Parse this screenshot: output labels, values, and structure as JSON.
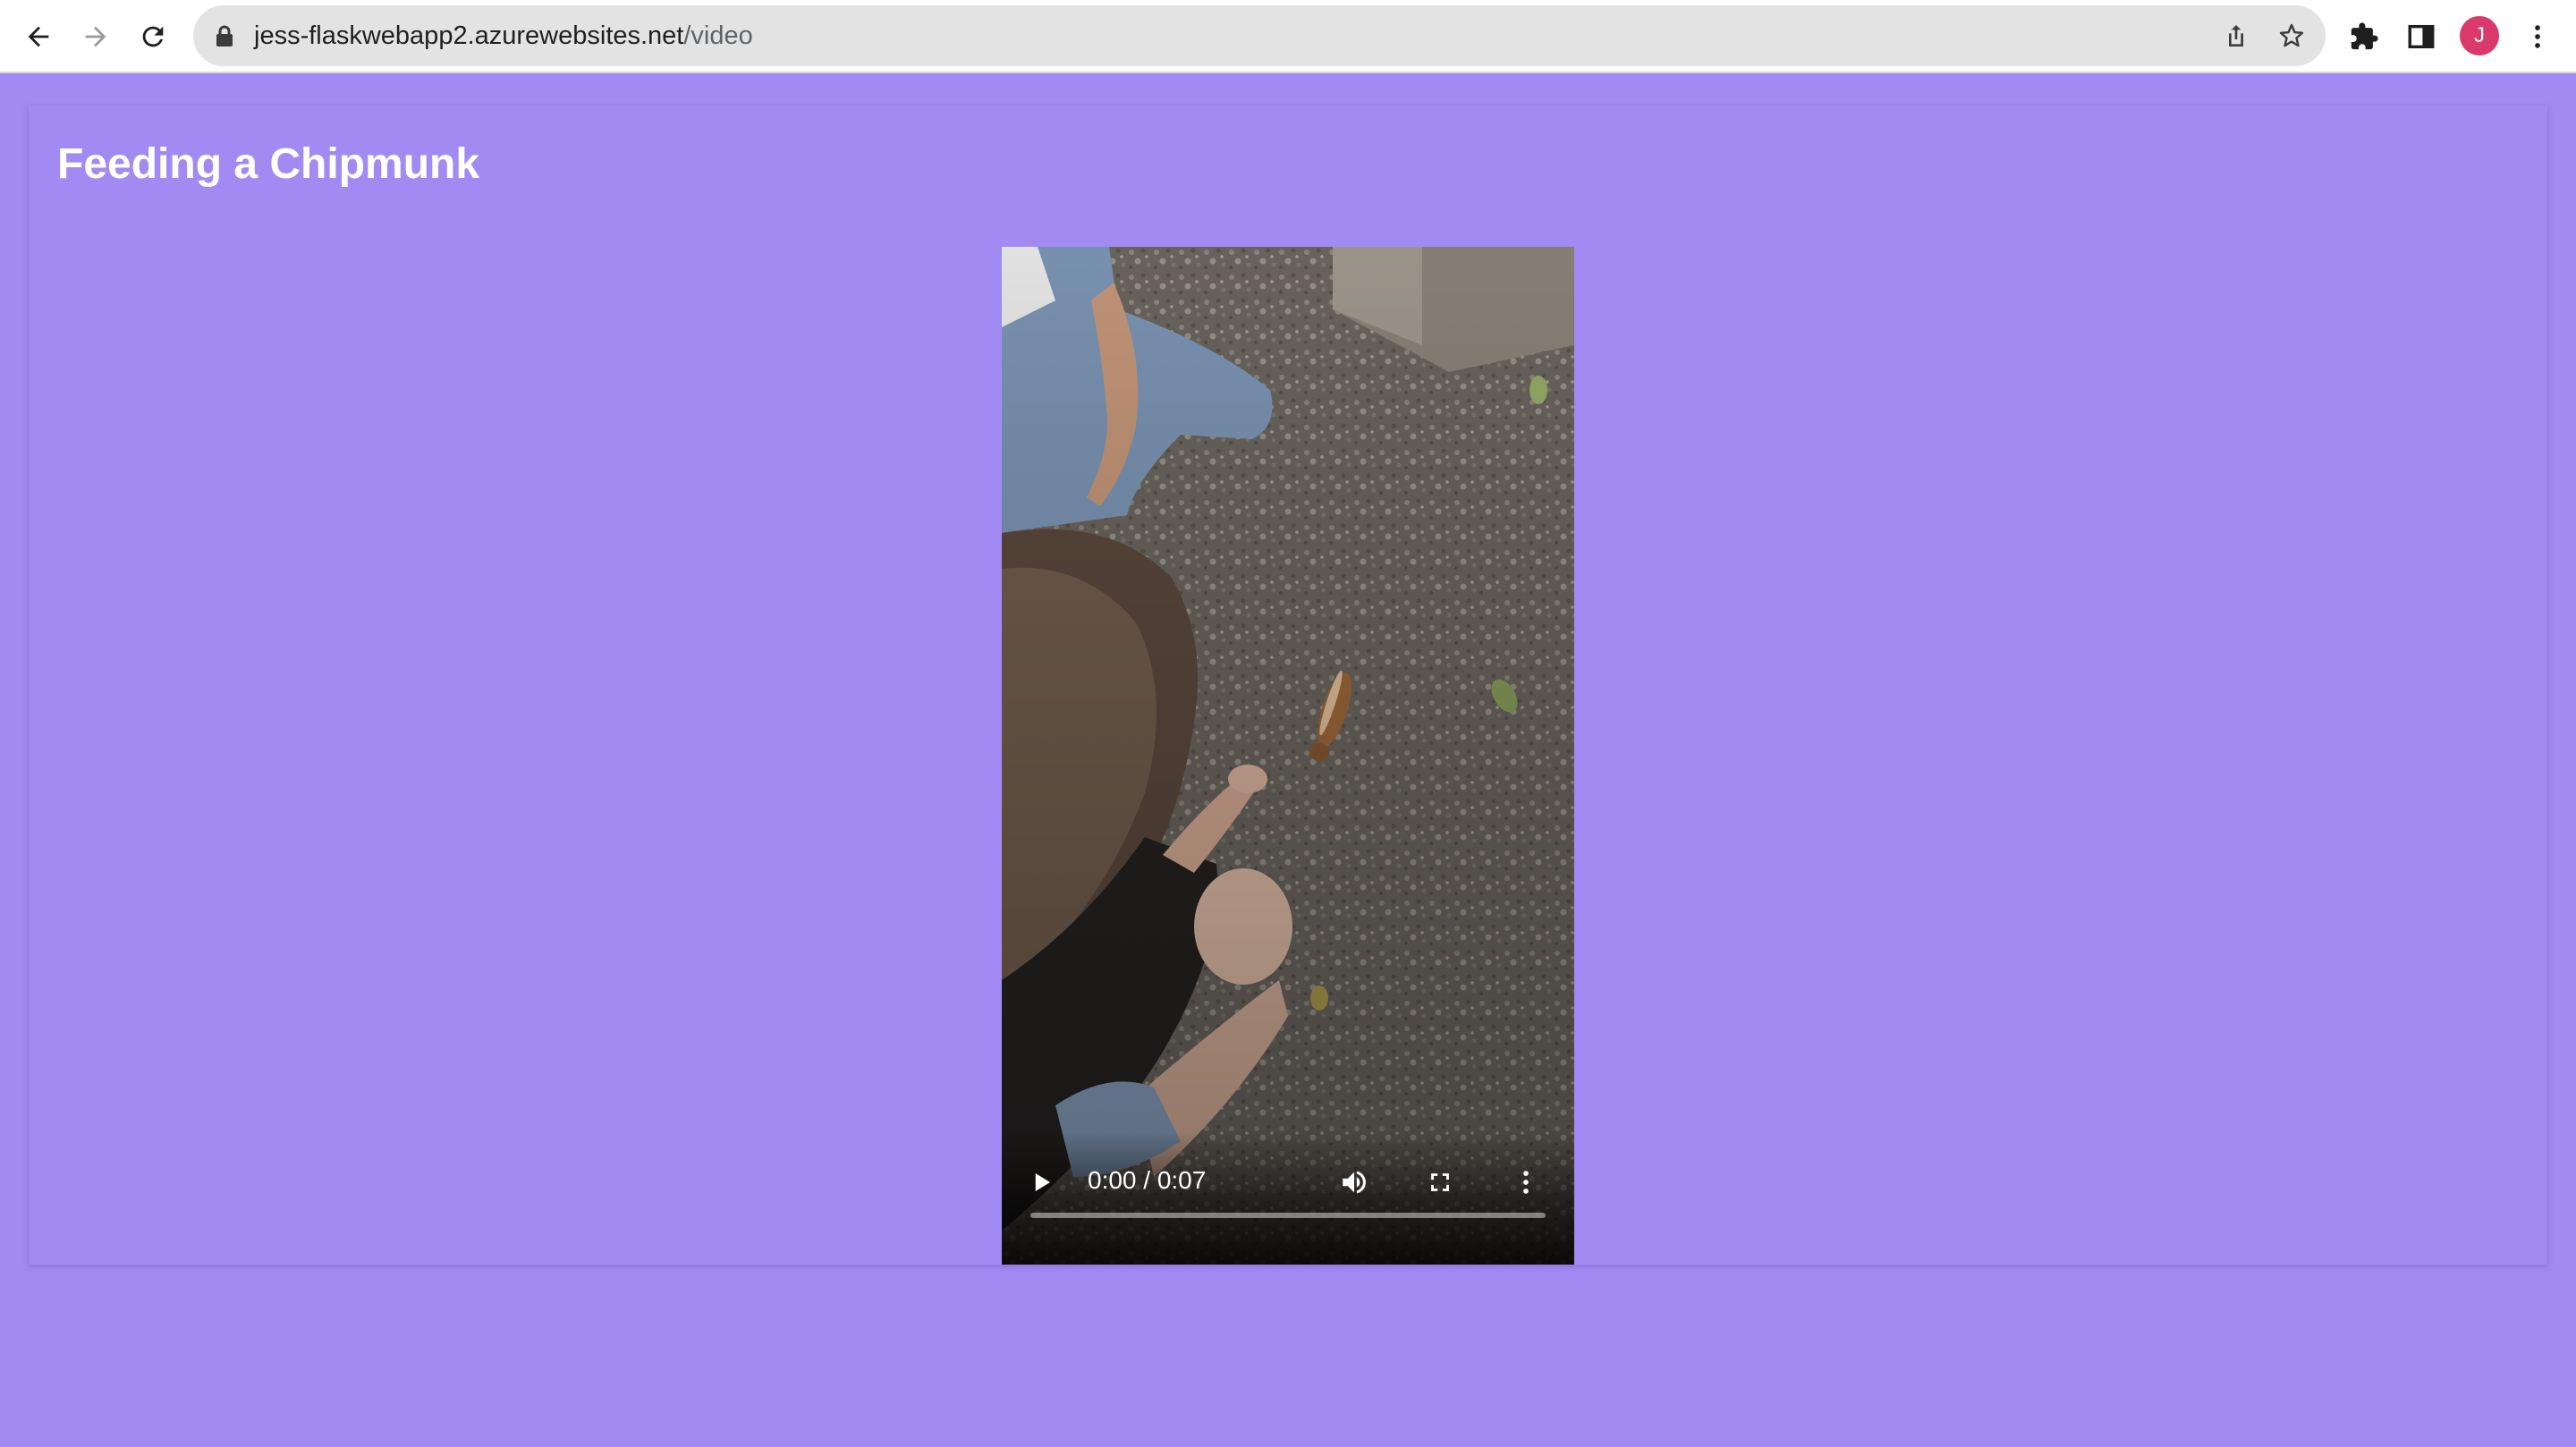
{
  "browser": {
    "url_host": "jess-flaskwebapp2.azurewebsites.net",
    "url_path": "/video",
    "profile_initial": "J",
    "icons": {
      "back": "back-arrow-icon",
      "forward": "forward-arrow-icon",
      "reload": "reload-icon",
      "lock": "lock-icon",
      "share": "share-icon",
      "bookmark": "star-icon",
      "extensions": "puzzle-icon",
      "side_panel": "side-panel-icon",
      "menu": "kebab-menu-icon"
    }
  },
  "page": {
    "title": "Feeding a Chipmunk",
    "background_color": "#a18bf2"
  },
  "video": {
    "current_time": "0:00",
    "separator": "/",
    "duration": "0:07",
    "time_display": "0:00 / 0:07",
    "progress_fraction": 0.0,
    "icons": {
      "play": "play-icon",
      "volume": "volume-icon",
      "fullscreen": "fullscreen-icon",
      "more": "more-options-icon"
    }
  }
}
